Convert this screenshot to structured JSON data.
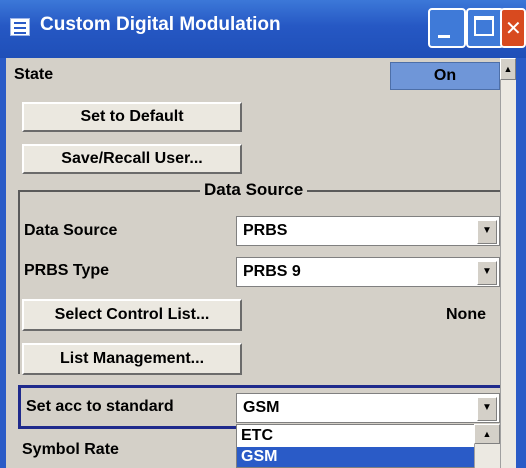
{
  "window": {
    "title": "Custom Digital Modulation"
  },
  "state": {
    "label": "State",
    "value": "On"
  },
  "buttons": {
    "set_default": "Set to Default",
    "save_recall": "Save/Recall User...",
    "select_control_list": "Select Control List...",
    "list_management": "List Management..."
  },
  "data_source_group": {
    "title": "Data Source",
    "data_source": {
      "label": "Data Source",
      "value": "PRBS"
    },
    "prbs_type": {
      "label": "PRBS Type",
      "value": "PRBS 9"
    },
    "control_list_value": "None"
  },
  "standard": {
    "label": "Set acc to standard",
    "value": "GSM",
    "options": [
      "ETC",
      "GSM"
    ],
    "highlighted_option": "GSM"
  },
  "symbol_rate": {
    "label": "Symbol Rate"
  },
  "colors": {
    "titlebar": "#2658c4",
    "state_on": "#6f96d8",
    "highlight": "#2a5bc7",
    "close": "#d84a1f"
  }
}
